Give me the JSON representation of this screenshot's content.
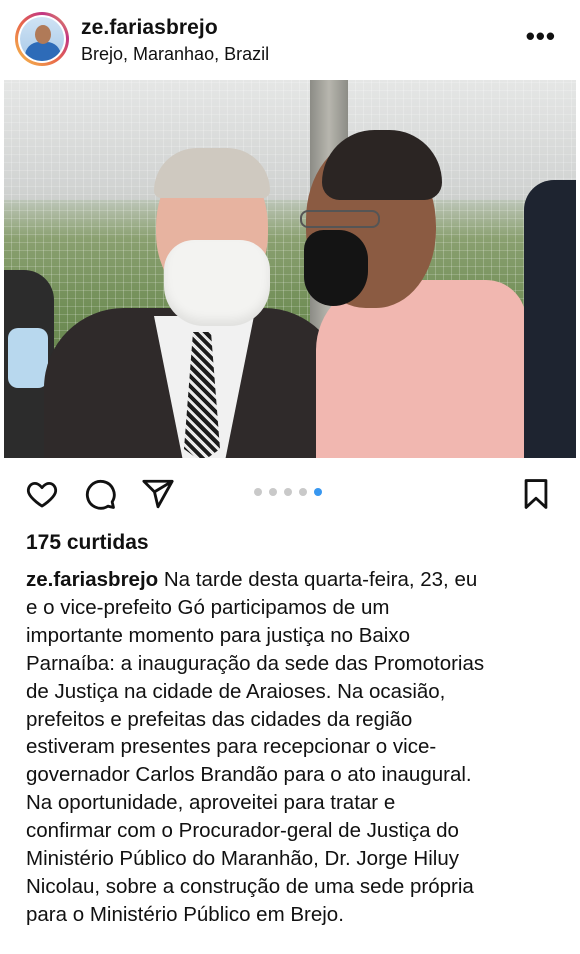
{
  "post": {
    "username": "ze.fariasbrejo",
    "location": "Brejo, Maranhao, Brazil",
    "more_label": "•••",
    "likes_text": "175 curtidas",
    "carousel": {
      "total": 5,
      "active_index": 4
    },
    "caption_lines": [
      " Na tarde desta quarta-feira, 23, eu",
      "e o vice-prefeito Gó participamos de um",
      "importante momento para justiça no Baixo",
      "Parnaíba: a inauguração da sede das Promotorias",
      "de Justiça na cidade de Araioses. Na ocasião,",
      "prefeitos e prefeitas das cidades da região",
      "estiveram presentes para recepcionar o vice-",
      "governador Carlos Brandão para o ato inaugural.",
      "Na oportunidade, aproveitei para tratar e",
      "confirmar com o Procurador-geral de Justiça do",
      "Ministério Público do Maranhão, Dr. Jorge Hiluy",
      "Nicolau, sobre a construção de uma sede própria",
      "para o Ministério Público em Brejo."
    ]
  },
  "icons": {
    "like": "heart-icon",
    "comment": "comment-icon",
    "share": "send-icon",
    "save": "bookmark-icon",
    "more": "more-options-icon"
  },
  "colors": {
    "carousel_active": "#3897f0",
    "carousel_inactive": "#c9c9c9",
    "text": "#111111"
  }
}
